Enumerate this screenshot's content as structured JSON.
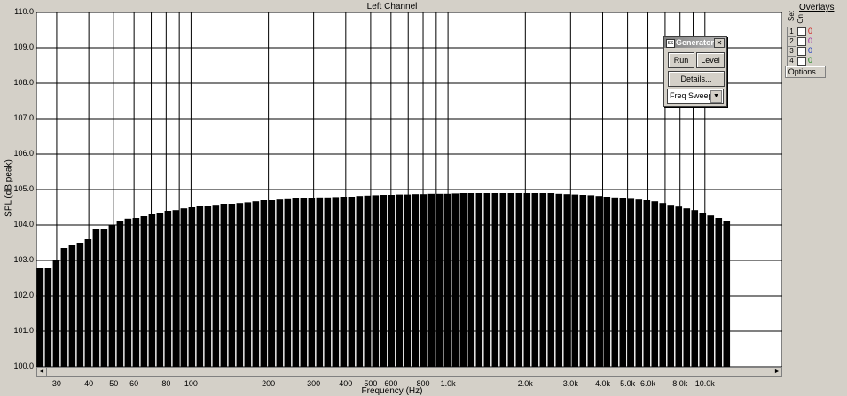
{
  "chart_data": {
    "type": "bar",
    "title": "Left Channel",
    "xlabel": "Frequency (Hz)",
    "ylabel": "SPL (dB peak)",
    "x_scale": "log",
    "xlim": [
      25,
      20000
    ],
    "ylim": [
      100.0,
      110.0
    ],
    "grid": true,
    "yticks": [
      "100.0",
      "101.0",
      "102.0",
      "103.0",
      "104.0",
      "105.0",
      "106.0",
      "107.0",
      "108.0",
      "109.0",
      "110.0"
    ],
    "xticks": [
      {
        "f": 30,
        "label": "30"
      },
      {
        "f": 40,
        "label": "40"
      },
      {
        "f": 50,
        "label": "50"
      },
      {
        "f": 60,
        "label": "60"
      },
      {
        "f": 80,
        "label": "80"
      },
      {
        "f": 100,
        "label": "100"
      },
      {
        "f": 200,
        "label": "200"
      },
      {
        "f": 300,
        "label": "300"
      },
      {
        "f": 400,
        "label": "400"
      },
      {
        "f": 500,
        "label": "500"
      },
      {
        "f": 600,
        "label": "600"
      },
      {
        "f": 800,
        "label": "800"
      },
      {
        "f": 1000,
        "label": "1.0k"
      },
      {
        "f": 2000,
        "label": "2.0k"
      },
      {
        "f": 3000,
        "label": "3.0k"
      },
      {
        "f": 4000,
        "label": "4.0k"
      },
      {
        "f": 5000,
        "label": "5.0k"
      },
      {
        "f": 6000,
        "label": "6.0k"
      },
      {
        "f": 8000,
        "label": "8.0k"
      },
      {
        "f": 10000,
        "label": "10.0k"
      }
    ],
    "gridlines_hz": [
      30,
      40,
      50,
      60,
      70,
      80,
      90,
      100,
      200,
      300,
      400,
      500,
      600,
      700,
      800,
      900,
      1000,
      2000,
      3000,
      4000,
      5000,
      6000,
      7000,
      8000,
      9000,
      10000,
      20000
    ],
    "band_start_hz": 25,
    "band_end_hz": 12600,
    "values": [
      102.8,
      102.8,
      103.0,
      103.35,
      103.45,
      103.5,
      103.6,
      103.9,
      103.9,
      104.0,
      104.1,
      104.18,
      104.2,
      104.25,
      104.3,
      104.35,
      104.4,
      104.42,
      104.47,
      104.5,
      104.53,
      104.55,
      104.57,
      104.6,
      104.6,
      104.62,
      104.64,
      104.67,
      104.7,
      104.7,
      104.72,
      104.73,
      104.75,
      104.76,
      104.77,
      104.78,
      104.78,
      104.79,
      104.8,
      104.8,
      104.82,
      104.83,
      104.84,
      104.85,
      104.85,
      104.86,
      104.86,
      104.87,
      104.87,
      104.88,
      104.88,
      104.88,
      104.89,
      104.9,
      104.9,
      104.9,
      104.9,
      104.9,
      104.9,
      104.9,
      104.9,
      104.9,
      104.9,
      104.9,
      104.9,
      104.88,
      104.87,
      104.86,
      104.85,
      104.84,
      104.82,
      104.8,
      104.78,
      104.76,
      104.74,
      104.72,
      104.7,
      104.67,
      104.62,
      104.57,
      104.52,
      104.47,
      104.42,
      104.35,
      104.27,
      104.2,
      104.1
    ]
  },
  "scrollbar": {
    "left_arrow": "◄",
    "right_arrow": "►"
  },
  "overlays": {
    "title": "Overlays",
    "header_set": "Set",
    "header_on": "On",
    "rows": [
      {
        "num": "1",
        "value": "0",
        "color": "#d01010"
      },
      {
        "num": "2",
        "value": "0",
        "color": "#a020a0"
      },
      {
        "num": "3",
        "value": "0",
        "color": "#1030c0"
      },
      {
        "num": "4",
        "value": "0",
        "color": "#108010"
      }
    ],
    "options_label": "Options..."
  },
  "generator": {
    "icon_text": "SS",
    "title": "Generator",
    "close_label": "✕",
    "run_label": "Run",
    "level_label": "Level",
    "details_label": "Details...",
    "mode_value": "Freq Sweep",
    "mode_arrow": "▼"
  },
  "colors": {
    "plot_bg": "#ffffff",
    "bar": "#000000",
    "grid": "#000000",
    "window_bg": "#d4d0c8"
  }
}
